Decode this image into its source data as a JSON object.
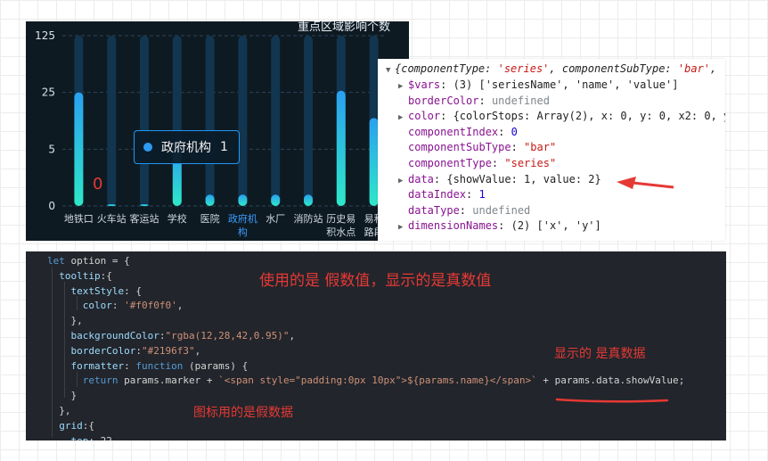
{
  "chart": {
    "title": "重点区域影响个数",
    "y_ticks": [
      "125",
      "25",
      "5",
      "0"
    ],
    "categories": [
      "地铁口",
      "火车站",
      "客运站",
      "学校",
      "医院",
      "政府机\n构",
      "水厂",
      "消防站",
      "历史易\n积水点",
      "易积\n路段"
    ],
    "active_category_index": 5,
    "zero_annotation": "0",
    "tooltip": {
      "name": "政府机构",
      "value": "1",
      "marker_color": "#2d9bf0",
      "border_color": "#2196f3"
    },
    "colors": {
      "bar_top": "#2aa0f0",
      "bar_bottom": "#2ee8c8",
      "bar_bg": "#123550",
      "background": "#0e1a22"
    }
  },
  "chart_data": {
    "type": "bar",
    "title": "重点区域影响个数",
    "categories": [
      "地铁口",
      "火车站",
      "客运站",
      "学校",
      "医院",
      "政府机构",
      "水厂",
      "消防站",
      "历史易积水点",
      "易积路段"
    ],
    "values": [
      25,
      0,
      0,
      5,
      1,
      1,
      1,
      1,
      28,
      16
    ],
    "y_ticks": [
      0,
      5,
      25,
      125
    ],
    "ylim": [
      0,
      125
    ],
    "y_scale": "compressed",
    "grid": true
  },
  "devtools": {
    "header": {
      "text_before": "{componentType: ",
      "str1": "'series'",
      "text_mid": ", componentSubType: ",
      "str2": "'bar'",
      "text_end": ","
    },
    "rows": [
      {
        "expandable": true,
        "key": "$vars",
        "value": "(3) ['seriesName', 'name', 'value']",
        "kind": "plain"
      },
      {
        "expandable": false,
        "key": "borderColor",
        "value": "undefined",
        "kind": "undef"
      },
      {
        "expandable": true,
        "key": "color",
        "value": "{colorStops: Array(2), x: 0, y: 0, x2: 0, y",
        "kind": "plain"
      },
      {
        "expandable": false,
        "key": "componentIndex",
        "value": "0",
        "kind": "num"
      },
      {
        "expandable": false,
        "key": "componentSubType",
        "value": "\"bar\"",
        "kind": "str"
      },
      {
        "expandable": false,
        "key": "componentType",
        "value": "\"series\"",
        "kind": "str"
      },
      {
        "expandable": true,
        "key": "data",
        "value": "{showValue: 1, value: 2}",
        "kind": "plain"
      },
      {
        "expandable": false,
        "key": "dataIndex",
        "value": "1",
        "kind": "num"
      },
      {
        "expandable": false,
        "key": "dataType",
        "value": "undefined",
        "kind": "undef"
      },
      {
        "expandable": true,
        "key": "dimensionNames",
        "value": "(2) ['x', 'y']",
        "kind": "plain"
      }
    ],
    "arrow_color": "#e53935"
  },
  "code": {
    "lines": [
      "let option = {",
      "  tooltip:{",
      "    textStyle: {",
      "      color: '#f0f0f0',",
      "    },",
      "    backgroundColor:\"rgba(12,28,42,0.95)\",",
      "    borderColor:\"#2196f3\",",
      "    formatter: function (params) {",
      "      return params.marker + `<span style=\"padding:0px 10px\">${params.name}</span>` + params.data.showValue;",
      "    }",
      "  },",
      "  grid:{",
      "    top: 22"
    ]
  },
  "annotations": {
    "fake_vs_real": "使用的是 假数值，显示的是真数值",
    "shows_real": "显示的 是真数据",
    "chart_uses_fake": "图标用的是假数据",
    "color": "#e53935"
  }
}
